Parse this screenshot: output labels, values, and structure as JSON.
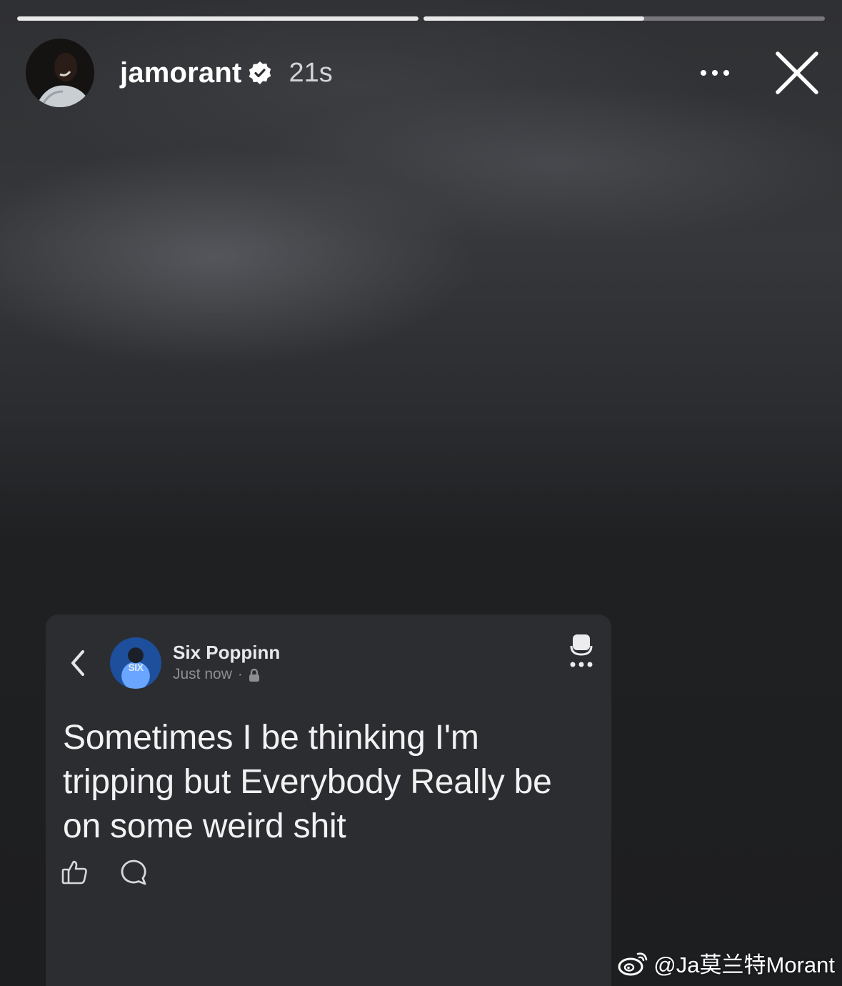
{
  "story": {
    "progress": [
      1.0,
      0.55
    ],
    "header": {
      "username": "jamorant",
      "verified": true,
      "time": "21s",
      "more_icon": "more-horizontal-icon",
      "close_icon": "close-icon"
    }
  },
  "post": {
    "back_icon": "chevron-left-icon",
    "author": "Six Poppinn",
    "timestamp": "Just now",
    "separator": "·",
    "privacy_icon": "lock-icon",
    "menu_icon": "more-options-icon",
    "text": "Sometimes I be thinking I'm tripping but Everybody Really be on some weird shit",
    "actions": [
      {
        "name": "like",
        "icon": "thumbs-up-icon"
      },
      {
        "name": "comment",
        "icon": "comment-icon"
      }
    ]
  },
  "watermark": {
    "logo_icon": "weibo-icon",
    "text": "@Ja莫兰特Morant"
  },
  "colors": {
    "background": "#1e1f21",
    "card": "#2c2d30",
    "text_primary": "#f2f2f3",
    "text_secondary": "#8d8e92"
  }
}
